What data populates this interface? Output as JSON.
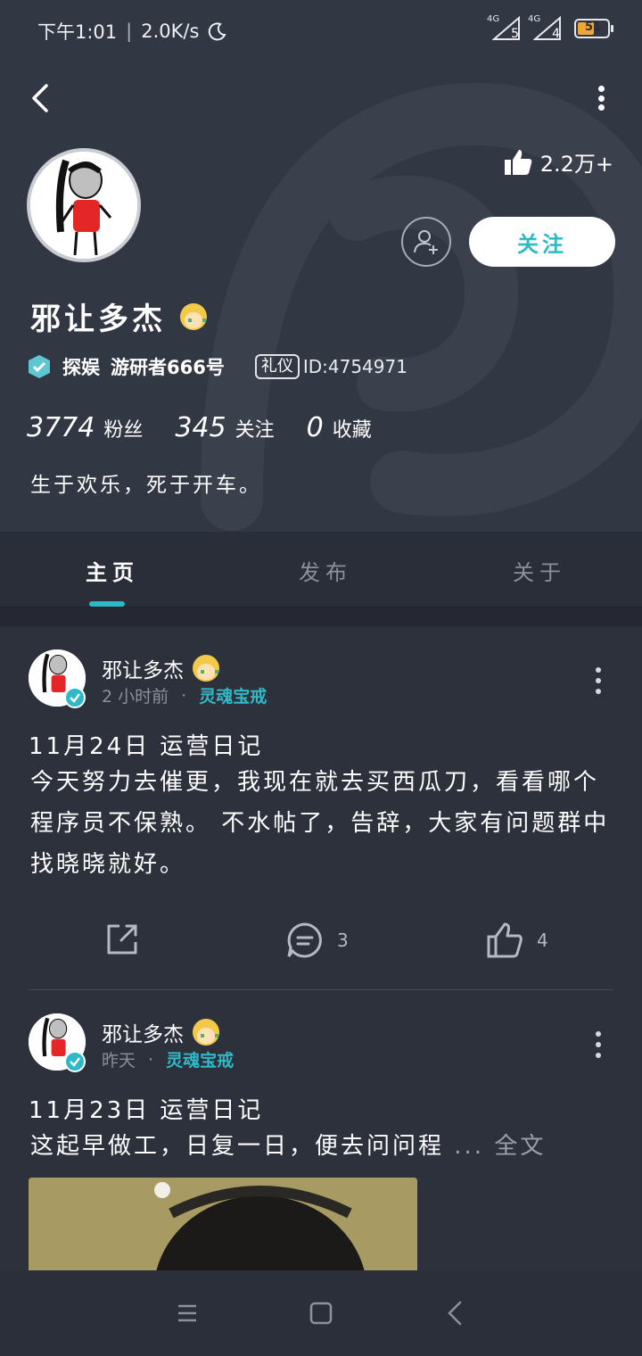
{
  "status_bar": {
    "time": "下午1:01",
    "net_speed": "2.0K/s",
    "sim1": {
      "type": "4G",
      "signal": "5"
    },
    "sim2": {
      "type": "4G",
      "signal": "4"
    },
    "battery": "51"
  },
  "profile": {
    "likes": "2.2万+",
    "follow_label": "关注",
    "name": "邪让多杰",
    "cert_title": "探娱",
    "cert_desc": "游研者666号",
    "tag": "礼仪",
    "uid": "ID:4754971",
    "stats": [
      {
        "num": "3774",
        "label": "粉丝"
      },
      {
        "num": "345",
        "label": "关注"
      },
      {
        "num": "0",
        "label": "收藏"
      }
    ],
    "bio": "生于欢乐，死于开车。"
  },
  "tabs": [
    "主页",
    "发布",
    "关于"
  ],
  "posts": [
    {
      "author": "邪让多杰",
      "time": "2 小时前",
      "dot": "·",
      "ring": "灵魂宝戒",
      "title": "11月24日  运营日记",
      "body": "今天努力去催更，我现在就去买西瓜刀，看看哪个程序员不保熟。 不水帖了，告辞，大家有问题群中找晓晓就好。",
      "comments": "3",
      "likes": "4"
    },
    {
      "author": "邪让多杰",
      "time": "昨天",
      "dot": "·",
      "ring": "灵魂宝戒",
      "title": "11月23日  运营日记",
      "body": "这起早做工，日复一日，便去问问程",
      "more": "... 全文"
    }
  ],
  "colors": {
    "accent": "#2fb8c6",
    "header_bg": "#323744",
    "feed_bg": "#2d313c"
  }
}
